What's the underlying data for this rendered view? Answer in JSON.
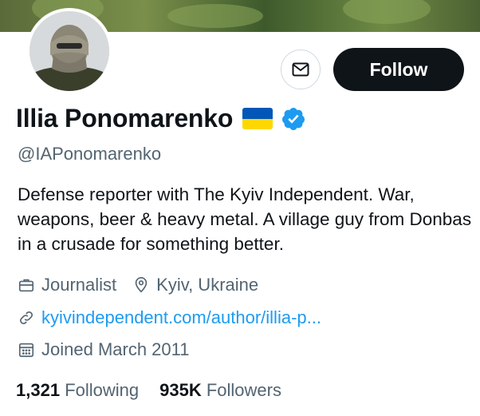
{
  "profile": {
    "name": "Illia Ponomarenko",
    "handle": "@IAPonomarenko",
    "bio": "Defense reporter with The Kyiv Independent. War, weapons, beer & heavy metal. A village guy from Donbas in a crusade for something better.",
    "category": "Journalist",
    "location": "Kyiv, Ukraine",
    "website": "kyivindependent.com/author/illia-p...",
    "joined": "Joined March 2011",
    "following_count": "1,321",
    "following_label": "Following",
    "followers_count": "935K",
    "followers_label": "Followers",
    "verified": true
  },
  "actions": {
    "follow_label": "Follow",
    "message_icon": "envelope-icon"
  },
  "colors": {
    "accent": "#1d9bf0",
    "text": "#0f1419",
    "muted": "#536471",
    "flag_blue": "#0057b7",
    "flag_yellow": "#ffd700"
  }
}
